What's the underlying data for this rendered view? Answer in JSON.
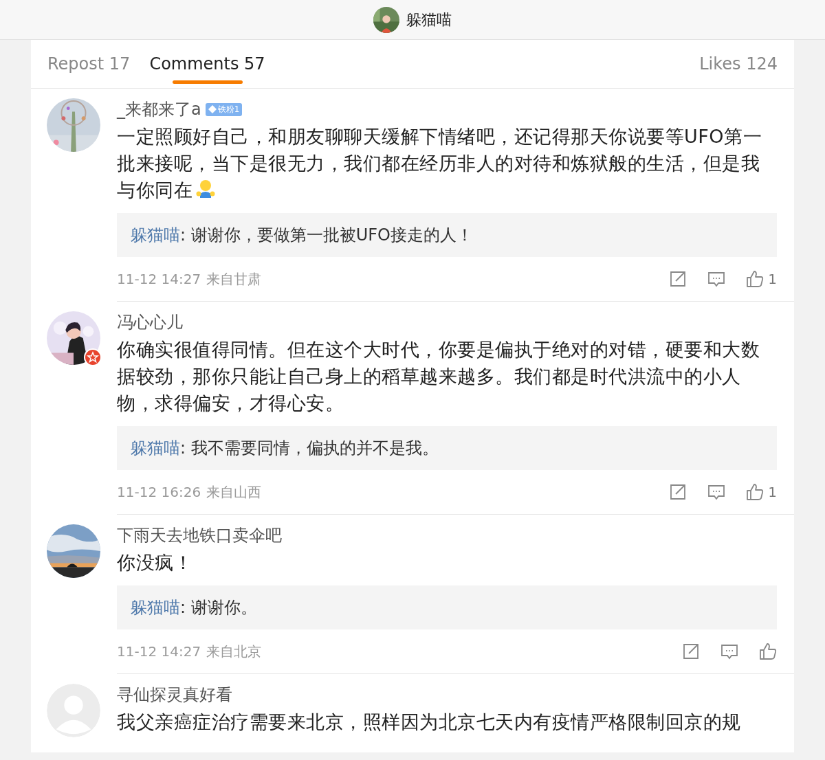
{
  "header": {
    "title": "躲猫喵"
  },
  "tabs": [
    {
      "label": "Repost 17",
      "selected": false
    },
    {
      "label": "Comments 57",
      "selected": true
    },
    {
      "label": "Likes 124",
      "selected": false
    }
  ],
  "comments": [
    {
      "author": "_来都来了a",
      "badge": "铁粉1",
      "verified": false,
      "text": "一定照顾好自己，和朋友聊聊天缓解下情绪吧，还记得那天你说要等UFO第一批来接呢，当下是很无力，我们都在经历非人的对待和炼狱般的生活，但是我与你同在",
      "emoji": true,
      "reply": {
        "author": "躲猫喵",
        "text": ": 谢谢你，要做第一批被UFO接走的人！"
      },
      "time": "11-12 14:27",
      "source": "来自甘肃",
      "likes": "1"
    },
    {
      "author": "冯心心儿",
      "verified": true,
      "text": "你确实很值得同情。但在这个大时代，你要是偏执于绝对的对错，硬要和大数据较劲，那你只能让自己身上的稻草越来越多。我们都是时代洪流中的小人物，求得偏安，才得心安。",
      "emoji": false,
      "reply": {
        "author": "躲猫喵",
        "text": ": 我不需要同情，偏执的并不是我。"
      },
      "time": "11-12 16:26",
      "source": "来自山西",
      "likes": "1"
    },
    {
      "author": "下雨天去地铁口卖伞吧",
      "verified": false,
      "text": "你没疯！",
      "emoji": false,
      "reply": {
        "author": "躲猫喵",
        "text": ": 谢谢你。"
      },
      "time": "11-12 14:27",
      "source": "来自北京"
    },
    {
      "author": "寻仙探灵真好看",
      "verified": false,
      "avatar": {
        "kind": "default"
      },
      "text": "我父亲癌症治疗需要来北京，照样因为北京七天内有疫情严格限制回京的规",
      "emoji": false
    }
  ]
}
